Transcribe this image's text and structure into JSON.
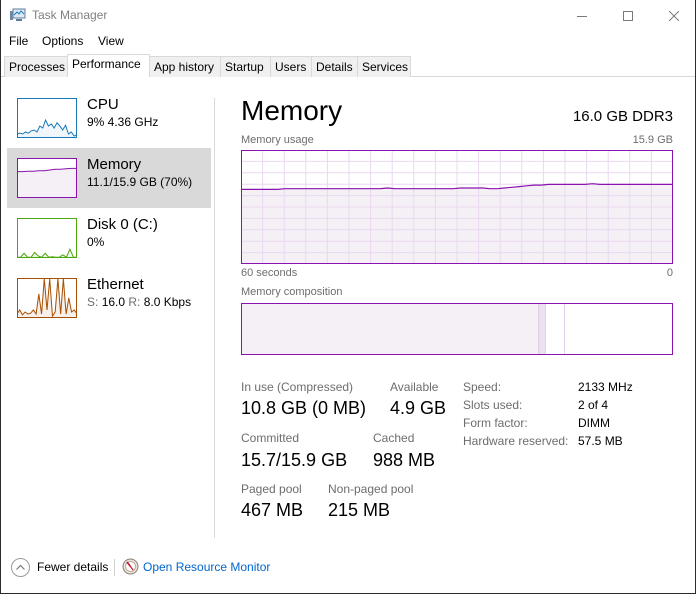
{
  "window": {
    "title": "Task Manager",
    "icon": "task-manager-icon",
    "controls": [
      "minimize",
      "maximize",
      "close"
    ]
  },
  "menu": [
    "File",
    "Options",
    "View"
  ],
  "tabs": [
    {
      "label": "Processes",
      "active": false
    },
    {
      "label": "Performance",
      "active": true
    },
    {
      "label": "App history",
      "active": false
    },
    {
      "label": "Startup",
      "active": false
    },
    {
      "label": "Users",
      "active": false
    },
    {
      "label": "Details",
      "active": false
    },
    {
      "label": "Services",
      "active": false
    }
  ],
  "sidebar": {
    "items": [
      {
        "title": "CPU",
        "sub": "9%  4.36 GHz",
        "color": "#1779ba",
        "fill": "#f1f6fa",
        "selected": false
      },
      {
        "title": "Memory",
        "sub": "11.1/15.9 GB (70%)",
        "color": "#8b12ae",
        "fill": "#f4f0f5",
        "selected": true
      },
      {
        "title": "Disk 0 (C:)",
        "sub": "0%",
        "color": "#4da60c",
        "fill": "#eff7ea",
        "selected": false
      },
      {
        "title": "Ethernet",
        "sub_s_label": "S:",
        "sub_s_value": "16.0",
        "sub_r_label": "R:",
        "sub_r_value": "8.0 Kbps",
        "color": "#a74f01",
        "fill": "#f6efea",
        "selected": false
      }
    ]
  },
  "main": {
    "title": "Memory",
    "spec": "16.0 GB DDR3",
    "usage_label": "Memory usage",
    "usage_max": "15.9 GB",
    "time_label": "60 seconds",
    "time_end": "0",
    "composition_label": "Memory composition",
    "accent": "#8b12ae",
    "usage_history_gb": [
      10.4,
      10.4,
      10.4,
      10.4,
      10.4,
      10.4,
      10.5,
      10.5,
      10.5,
      10.5,
      10.5,
      10.5,
      10.5,
      10.5,
      10.5,
      10.5,
      10.5,
      10.5,
      10.5,
      10.5,
      10.6,
      10.5,
      10.5,
      10.5,
      10.5,
      10.5,
      10.5,
      10.5,
      10.5,
      10.5,
      10.6,
      10.6,
      10.6,
      10.6,
      10.5,
      10.5,
      10.6,
      10.7,
      10.8,
      10.9,
      11.0,
      11.0,
      11.1,
      11.1,
      11.1,
      11.1,
      11.1,
      11.1,
      11.2,
      11.1,
      11.1,
      11.1,
      11.1,
      11.1,
      11.1,
      11.1,
      11.1,
      11.1,
      11.1,
      11.1
    ],
    "usage_max_gb": 15.9,
    "composition": {
      "in_use_fraction": 0.69,
      "modified_fraction": 0.015,
      "standby_fraction": 0.045,
      "free_fraction": 0.25
    },
    "stats": {
      "in_use_label": "In use (Compressed)",
      "in_use_value": "10.8 GB (0 MB)",
      "available_label": "Available",
      "available_value": "4.9 GB",
      "committed_label": "Committed",
      "committed_value": "15.7/15.9 GB",
      "cached_label": "Cached",
      "cached_value": "988 MB",
      "paged_label": "Paged pool",
      "paged_value": "467 MB",
      "nonpaged_label": "Non-paged pool",
      "nonpaged_value": "215 MB"
    },
    "details": [
      {
        "key": "Speed:",
        "value": "2133 MHz"
      },
      {
        "key": "Slots used:",
        "value": "2 of 4"
      },
      {
        "key": "Form factor:",
        "value": "DIMM"
      },
      {
        "key": "Hardware reserved:",
        "value": "57.5 MB"
      }
    ]
  },
  "footer": {
    "fewer_details": "Fewer details",
    "resource_monitor": "Open Resource Monitor"
  }
}
